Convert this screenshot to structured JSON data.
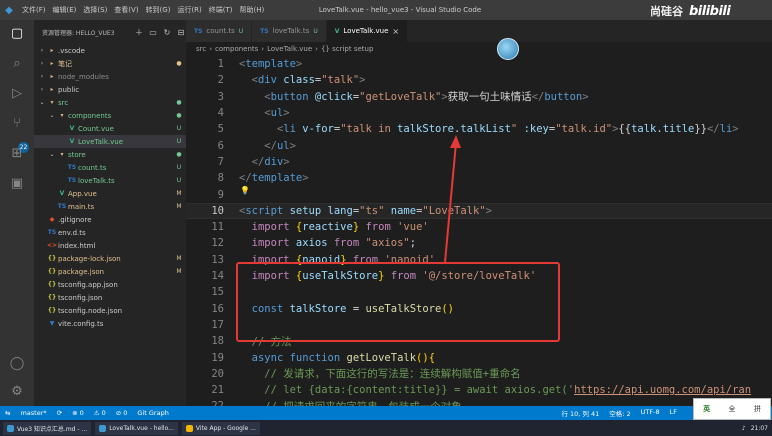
{
  "titlebar": {
    "menus": [
      "文件(F)",
      "编辑(E)",
      "选择(S)",
      "查看(V)",
      "转到(G)",
      "运行(R)",
      "终端(T)",
      "帮助(H)"
    ],
    "title": "LoveTalk.vue - hello_vue3 - Visual Studio Code",
    "brand_text": "尚硅谷",
    "brand_logo": "bilibili"
  },
  "activity": {
    "icons": [
      "files-icon",
      "search-icon",
      "run-debug-icon",
      "source-control-icon",
      "extensions-icon",
      "remote-explorer-icon",
      "account-icon",
      "settings-icon"
    ],
    "badge": "22"
  },
  "sidebar": {
    "title": "资源管理器: HELLO_VUE3",
    "items": [
      {
        "label": ".vscode",
        "type": "folder",
        "chev": "›",
        "depth": 0,
        "status": "",
        "color": "#cccccc",
        "icon": "▸"
      },
      {
        "label": "笔记",
        "type": "folder",
        "chev": "›",
        "depth": 0,
        "status": "●",
        "color": "#e2c08d",
        "icon": "▸"
      },
      {
        "label": "node_modules",
        "type": "folder",
        "chev": "›",
        "depth": 0,
        "status": "",
        "color": "#8c8c8c",
        "icon": "▸"
      },
      {
        "label": "public",
        "type": "folder",
        "chev": "›",
        "depth": 0,
        "status": "",
        "color": "#cccccc",
        "icon": "▸"
      },
      {
        "label": "src",
        "type": "folder",
        "chev": "⌄",
        "depth": 0,
        "status": "●",
        "color": "#73c991",
        "icon": "▾"
      },
      {
        "label": "components",
        "type": "folder",
        "chev": "⌄",
        "depth": 1,
        "status": "●",
        "color": "#73c991",
        "icon": "▾"
      },
      {
        "label": "Count.vue",
        "type": "vue",
        "chev": "",
        "depth": 2,
        "status": "U",
        "color": "#73c991",
        "icon": "V"
      },
      {
        "label": "LoveTalk.vue",
        "type": "vue",
        "chev": "",
        "depth": 2,
        "status": "U",
        "color": "#73c991",
        "icon": "V"
      },
      {
        "label": "store",
        "type": "folder",
        "chev": "⌄",
        "depth": 1,
        "status": "●",
        "color": "#73c991",
        "icon": "▾"
      },
      {
        "label": "count.ts",
        "type": "ts",
        "chev": "",
        "depth": 2,
        "status": "U",
        "color": "#73c991",
        "icon": "TS"
      },
      {
        "label": "loveTalk.ts",
        "type": "ts",
        "chev": "",
        "depth": 2,
        "status": "U",
        "color": "#73c991",
        "icon": "TS"
      },
      {
        "label": "App.vue",
        "type": "vue",
        "chev": "",
        "depth": 1,
        "status": "M",
        "color": "#e2c08d",
        "icon": "V"
      },
      {
        "label": "main.ts",
        "type": "ts",
        "chev": "",
        "depth": 1,
        "status": "M",
        "color": "#e2c08d",
        "icon": "TS"
      },
      {
        "label": ".gitignore",
        "type": "git",
        "chev": "",
        "depth": 0,
        "status": "",
        "color": "#cccccc",
        "icon": "◆"
      },
      {
        "label": "env.d.ts",
        "type": "ts",
        "chev": "",
        "depth": 0,
        "status": "",
        "color": "#cccccc",
        "icon": "TS"
      },
      {
        "label": "index.html",
        "type": "html",
        "chev": "",
        "depth": 0,
        "status": "",
        "color": "#cccccc",
        "icon": "<>"
      },
      {
        "label": "package-lock.json",
        "type": "json",
        "chev": "",
        "depth": 0,
        "status": "M",
        "color": "#e2c08d",
        "icon": "{}"
      },
      {
        "label": "package.json",
        "type": "json",
        "chev": "",
        "depth": 0,
        "status": "M",
        "color": "#e2c08d",
        "icon": "{}"
      },
      {
        "label": "tsconfig.app.json",
        "type": "json",
        "chev": "",
        "depth": 0,
        "status": "",
        "color": "#cccccc",
        "icon": "{}"
      },
      {
        "label": "tsconfig.json",
        "type": "json",
        "chev": "",
        "depth": 0,
        "status": "",
        "color": "#cccccc",
        "icon": "{}"
      },
      {
        "label": "tsconfig.node.json",
        "type": "json",
        "chev": "",
        "depth": 0,
        "status": "",
        "color": "#cccccc",
        "icon": "{}"
      },
      {
        "label": "vite.config.ts",
        "type": "ts",
        "chev": "",
        "depth": 0,
        "status": "",
        "color": "#cccccc",
        "icon": "▼"
      }
    ]
  },
  "tabs": [
    {
      "icon": "TS",
      "label": "count.ts",
      "status": "U",
      "active": false
    },
    {
      "icon": "TS",
      "label": "loveTalk.ts",
      "status": "U",
      "active": false
    },
    {
      "icon": "V",
      "label": "LoveTalk.vue",
      "status": "U",
      "active": true
    }
  ],
  "breadcrumb": [
    "src",
    "components",
    "LoveTalk.vue",
    "{} script setup"
  ],
  "editor": {
    "lines": [
      {
        "n": "1",
        "tokens": [
          [
            "t-punc",
            "<"
          ],
          [
            "t-tag",
            "template"
          ],
          [
            "t-punc",
            ">"
          ]
        ]
      },
      {
        "n": "2",
        "tokens": [
          [
            "t-txt",
            "  "
          ],
          [
            "t-punc",
            "<"
          ],
          [
            "t-tag",
            "div"
          ],
          [
            "t-txt",
            " "
          ],
          [
            "t-attr",
            "class"
          ],
          [
            "t-txt",
            "="
          ],
          [
            "t-str",
            "\"talk\""
          ],
          [
            "t-punc",
            ">"
          ]
        ]
      },
      {
        "n": "3",
        "tokens": [
          [
            "t-txt",
            "    "
          ],
          [
            "t-punc",
            "<"
          ],
          [
            "t-tag",
            "button"
          ],
          [
            "t-txt",
            " "
          ],
          [
            "t-attr",
            "@click"
          ],
          [
            "t-txt",
            "="
          ],
          [
            "t-str",
            "\"getLoveTalk\""
          ],
          [
            "t-punc",
            ">"
          ],
          [
            "t-txt",
            "获取一句土味情话"
          ],
          [
            "t-punc",
            "</"
          ],
          [
            "t-tag",
            "button"
          ],
          [
            "t-punc",
            ">"
          ]
        ]
      },
      {
        "n": "4",
        "tokens": [
          [
            "t-txt",
            "    "
          ],
          [
            "t-punc",
            "<"
          ],
          [
            "t-tag",
            "ul"
          ],
          [
            "t-punc",
            ">"
          ]
        ]
      },
      {
        "n": "5",
        "tokens": [
          [
            "t-txt",
            "      "
          ],
          [
            "t-punc",
            "<"
          ],
          [
            "t-tag",
            "li"
          ],
          [
            "t-txt",
            " "
          ],
          [
            "t-attr",
            "v-for"
          ],
          [
            "t-txt",
            "="
          ],
          [
            "t-str",
            "\"talk in "
          ],
          [
            "t-var",
            "talkStore"
          ],
          [
            "t-txt",
            "."
          ],
          [
            "t-var",
            "talkList"
          ],
          [
            "t-str",
            "\""
          ],
          [
            "t-txt",
            " "
          ],
          [
            "t-attr",
            ":key"
          ],
          [
            "t-txt",
            "="
          ],
          [
            "t-str",
            "\"talk.id\""
          ],
          [
            "t-punc",
            ">"
          ],
          [
            "t-txt",
            "{{"
          ],
          [
            "t-var",
            "talk"
          ],
          [
            "t-txt",
            "."
          ],
          [
            "t-var",
            "title"
          ],
          [
            "t-txt",
            "}}"
          ],
          [
            "t-punc",
            "</"
          ],
          [
            "t-tag",
            "li"
          ],
          [
            "t-punc",
            ">"
          ]
        ]
      },
      {
        "n": "6",
        "tokens": [
          [
            "t-txt",
            "    "
          ],
          [
            "t-punc",
            "</"
          ],
          [
            "t-tag",
            "ul"
          ],
          [
            "t-punc",
            ">"
          ]
        ]
      },
      {
        "n": "7",
        "tokens": [
          [
            "t-txt",
            "  "
          ],
          [
            "t-punc",
            "</"
          ],
          [
            "t-tag",
            "div"
          ],
          [
            "t-punc",
            ">"
          ]
        ]
      },
      {
        "n": "8",
        "tokens": [
          [
            "t-punc",
            "</"
          ],
          [
            "t-tag",
            "template"
          ],
          [
            "t-punc",
            ">"
          ]
        ]
      },
      {
        "n": "9",
        "tokens": []
      },
      {
        "n": "10",
        "tokens": [
          [
            "t-punc",
            "<"
          ],
          [
            "t-tag",
            "script"
          ],
          [
            "t-txt",
            " "
          ],
          [
            "t-attr",
            "setup"
          ],
          [
            "t-txt",
            " "
          ],
          [
            "t-attr",
            "lang"
          ],
          [
            "t-txt",
            "="
          ],
          [
            "t-str",
            "\"ts\""
          ],
          [
            "t-txt",
            " "
          ],
          [
            "t-attr",
            "name"
          ],
          [
            "t-txt",
            "="
          ],
          [
            "t-str",
            "\"LoveTalk\""
          ],
          [
            "t-punc",
            ">"
          ]
        ]
      },
      {
        "n": "11",
        "tokens": [
          [
            "t-txt",
            "  "
          ],
          [
            "t-key",
            "import"
          ],
          [
            "t-txt",
            " "
          ],
          [
            "t-brk",
            "{"
          ],
          [
            "t-var",
            "reactive"
          ],
          [
            "t-brk",
            "}"
          ],
          [
            "t-txt",
            " "
          ],
          [
            "t-key",
            "from"
          ],
          [
            "t-txt",
            " "
          ],
          [
            "t-str",
            "'vue'"
          ]
        ]
      },
      {
        "n": "12",
        "tokens": [
          [
            "t-txt",
            "  "
          ],
          [
            "t-key",
            "import"
          ],
          [
            "t-txt",
            " "
          ],
          [
            "t-var",
            "axios"
          ],
          [
            "t-txt",
            " "
          ],
          [
            "t-key",
            "from"
          ],
          [
            "t-txt",
            " "
          ],
          [
            "t-str",
            "\"axios\""
          ],
          [
            "t-txt",
            ";"
          ]
        ]
      },
      {
        "n": "13",
        "tokens": [
          [
            "t-txt",
            "  "
          ],
          [
            "t-key",
            "import"
          ],
          [
            "t-txt",
            " "
          ],
          [
            "t-brk",
            "{"
          ],
          [
            "t-var",
            "nanoid"
          ],
          [
            "t-brk",
            "}"
          ],
          [
            "t-txt",
            " "
          ],
          [
            "t-key",
            "from"
          ],
          [
            "t-txt",
            " "
          ],
          [
            "t-str",
            "'nanoid'"
          ]
        ]
      },
      {
        "n": "14",
        "tokens": [
          [
            "t-txt",
            "  "
          ],
          [
            "t-key",
            "import"
          ],
          [
            "t-txt",
            " "
          ],
          [
            "t-brk",
            "{"
          ],
          [
            "t-var",
            "useTalkStore"
          ],
          [
            "t-brk",
            "}"
          ],
          [
            "t-txt",
            " "
          ],
          [
            "t-key",
            "from"
          ],
          [
            "t-txt",
            " "
          ],
          [
            "t-str",
            "'@/store/loveTalk'"
          ]
        ]
      },
      {
        "n": "15",
        "tokens": []
      },
      {
        "n": "16",
        "tokens": [
          [
            "t-txt",
            "  "
          ],
          [
            "t-kw",
            "const"
          ],
          [
            "t-txt",
            " "
          ],
          [
            "t-var",
            "talkStore"
          ],
          [
            "t-txt",
            " = "
          ],
          [
            "t-fn",
            "useTalkStore"
          ],
          [
            "t-brk",
            "()"
          ]
        ]
      },
      {
        "n": "17",
        "tokens": []
      },
      {
        "n": "18",
        "tokens": [
          [
            "t-txt",
            "  "
          ],
          [
            "t-cmt",
            "// 方法"
          ]
        ]
      },
      {
        "n": "19",
        "tokens": [
          [
            "t-txt",
            "  "
          ],
          [
            "t-kw",
            "async"
          ],
          [
            "t-txt",
            " "
          ],
          [
            "t-kw",
            "function"
          ],
          [
            "t-txt",
            " "
          ],
          [
            "t-fn",
            "getLoveTalk"
          ],
          [
            "t-brk",
            "(){"
          ]
        ]
      },
      {
        "n": "20",
        "tokens": [
          [
            "t-txt",
            "    "
          ],
          [
            "t-cmt",
            "// 发请求，下面这行的写法是：连续解构赋值+重命名"
          ]
        ]
      },
      {
        "n": "21",
        "tokens": [
          [
            "t-txt",
            "    "
          ],
          [
            "t-cmt",
            "// let {data:{content:title}} = await axios.get('"
          ],
          [
            "t-url",
            "https://api.uomg.com/api/ran"
          ]
        ]
      },
      {
        "n": "22",
        "tokens": [
          [
            "t-txt",
            "    "
          ],
          [
            "t-cmt",
            "// 把请求回来的字符串，包装成一个对象"
          ]
        ]
      }
    ]
  },
  "status": {
    "branch": "master*",
    "sync": "⟳",
    "errors": "⊗ 0",
    "warnings": "⚠ 0",
    "ports": "⊘ 0",
    "graph": "Git Graph",
    "position": "行 10, 列 41",
    "spaces": "空格: 2",
    "encoding": "UTF-8",
    "eol": "LF"
  },
  "ime": {
    "a": "英",
    "b": "全",
    "c": "拼"
  },
  "taskbar": {
    "items": [
      {
        "label": "Vue3 知识点汇总.md - ...",
        "color": "#3c99d4"
      },
      {
        "label": "LoveTalk.vue - hello...",
        "color": "#3c99d4"
      },
      {
        "label": "Vite App - Google ...",
        "color": "#f4b400"
      }
    ],
    "time": "21:07"
  },
  "colors": {
    "accent": "#007acc",
    "annotation": "#e53935",
    "editor_bg": "#1e1e1e"
  }
}
